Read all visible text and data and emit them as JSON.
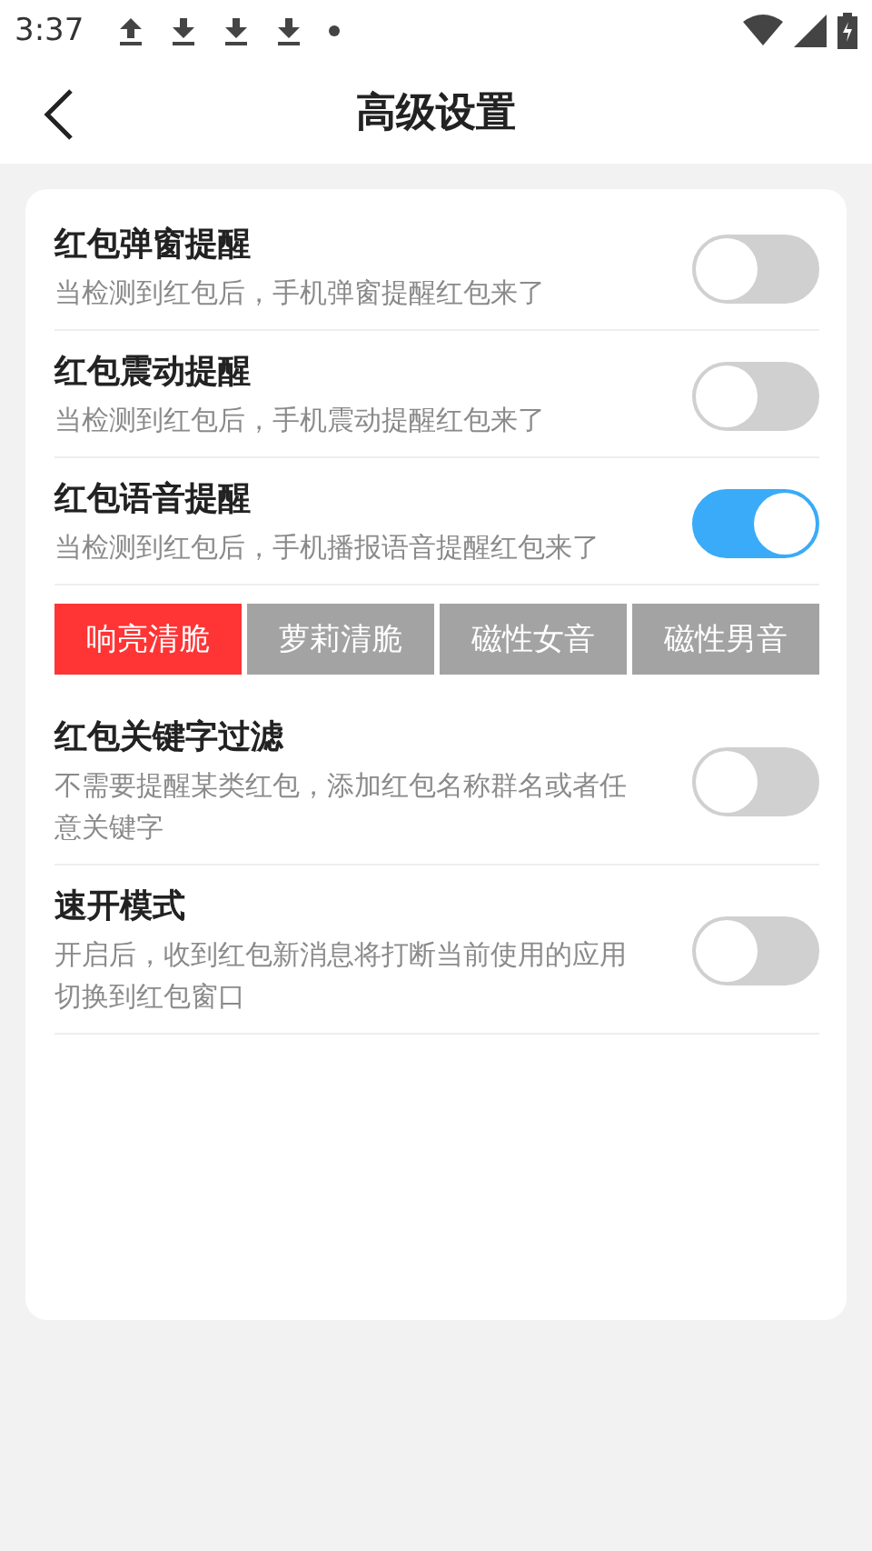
{
  "status_bar": {
    "time": "3:37"
  },
  "header": {
    "title": "高级设置"
  },
  "settings": [
    {
      "kind": "toggle",
      "title": "红包弹窗提醒",
      "description": "当检测到红包后，手机弹窗提醒红包来了",
      "on": false
    },
    {
      "kind": "toggle",
      "title": "红包震动提醒",
      "description": "当检测到红包后，手机震动提醒红包来了",
      "on": false
    },
    {
      "kind": "toggle",
      "title": "红包语音提醒",
      "description": "当检测到红包后，手机播报语音提醒红包来了",
      "on": true
    },
    {
      "kind": "options",
      "options": [
        {
          "label": "响亮清脆",
          "selected": true
        },
        {
          "label": "萝莉清脆",
          "selected": false
        },
        {
          "label": "磁性女音",
          "selected": false
        },
        {
          "label": "磁性男音",
          "selected": false
        }
      ]
    },
    {
      "kind": "toggle",
      "title": "红包关键字过滤",
      "description": "不需要提醒某类红包，添加红包名称群名或者任意关键字",
      "on": false
    },
    {
      "kind": "toggle",
      "title": "速开模式",
      "description": "开启后，收到红包新消息将打断当前使用的应用切换到红包窗口",
      "on": false
    }
  ]
}
